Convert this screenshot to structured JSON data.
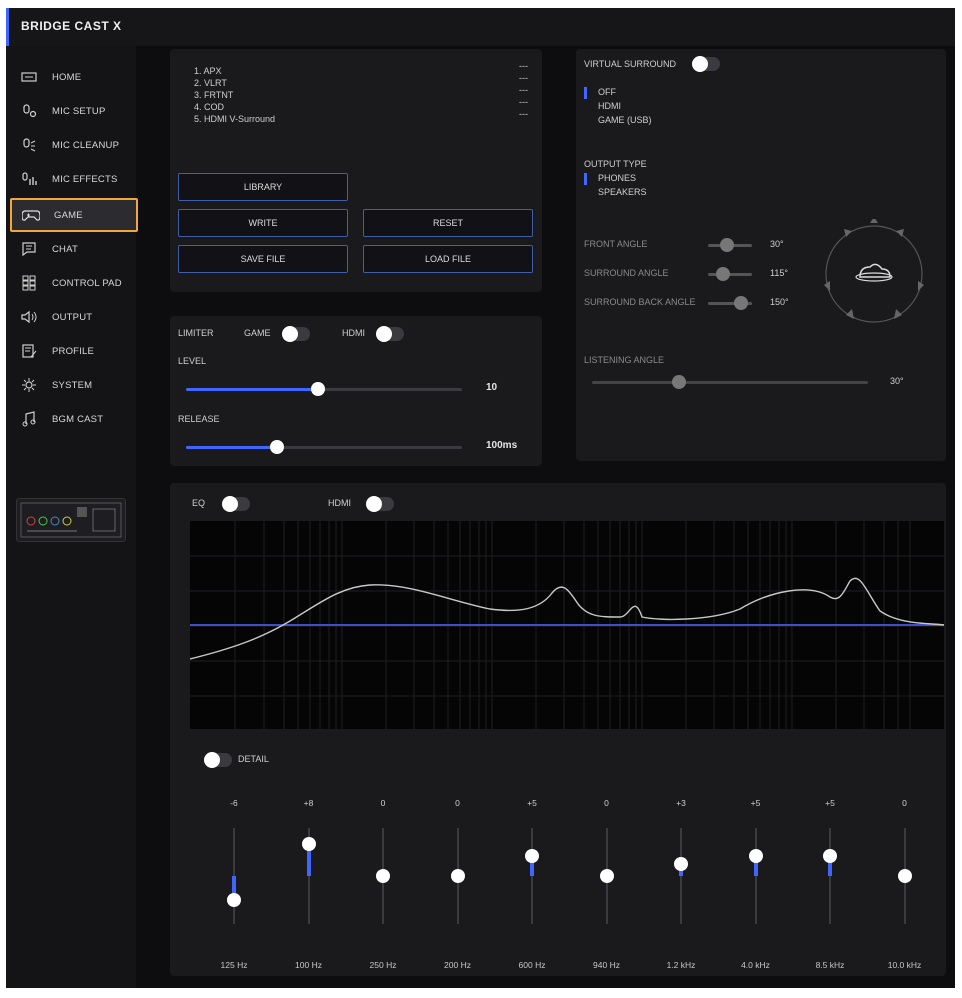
{
  "app": {
    "title": "BRIDGE CAST X"
  },
  "sidebar": {
    "items": [
      {
        "label": "HOME",
        "icon": "home-icon"
      },
      {
        "label": "MIC SETUP",
        "icon": "mic-setup-icon"
      },
      {
        "label": "MIC CLEANUP",
        "icon": "mic-cleanup-icon"
      },
      {
        "label": "MIC EFFECTS",
        "icon": "mic-effects-icon"
      },
      {
        "label": "GAME",
        "icon": "gamepad-icon",
        "active": true
      },
      {
        "label": "CHAT",
        "icon": "chat-icon"
      },
      {
        "label": "CONTROL PAD",
        "icon": "control-pad-icon"
      },
      {
        "label": "OUTPUT",
        "icon": "output-icon"
      },
      {
        "label": "PROFILE",
        "icon": "profile-icon"
      },
      {
        "label": "SYSTEM",
        "icon": "system-icon"
      },
      {
        "label": "BGM CAST",
        "icon": "music-icon"
      }
    ]
  },
  "library": {
    "presets": [
      {
        "name": "1. APX",
        "value": "---"
      },
      {
        "name": "2. VLRT",
        "value": "---"
      },
      {
        "name": "3. FRTNT",
        "value": "---"
      },
      {
        "name": "4. COD",
        "value": "---"
      },
      {
        "name": "5. HDMI V-Surround",
        "value": "---"
      }
    ],
    "library_label": "LIBRARY",
    "write_label": "WRITE",
    "reset_label": "RESET",
    "save_label": "SAVE FILE",
    "load_label": "LOAD FILE"
  },
  "limiter": {
    "title": "LIMITER",
    "game_label": "GAME",
    "hdmi_label": "HDMI",
    "level_label": "LEVEL",
    "level_value": "10",
    "level_fraction": 0.48,
    "release_label": "RELEASE",
    "release_value": "100ms",
    "release_fraction": 0.33
  },
  "surround": {
    "title": "VIRTUAL SURROUND",
    "modes": [
      "OFF",
      "HDMI",
      "GAME (USB)"
    ],
    "selected_mode": "OFF",
    "output_type_label": "OUTPUT TYPE",
    "output_types": [
      "PHONES",
      "SPEAKERS"
    ],
    "selected_output": "PHONES",
    "front_angle_label": "FRONT ANGLE",
    "front_angle_value": "30°",
    "surround_angle_label": "SURROUND ANGLE",
    "surround_angle_value": "115°",
    "surround_back_label": "SURROUND BACK ANGLE",
    "surround_back_value": "150°",
    "listening_angle_label": "LISTENING ANGLE",
    "listening_angle_value": "30°"
  },
  "eq": {
    "eq_label": "EQ",
    "hdmi_label": "HDMI",
    "detail_label": "DETAIL",
    "bands": [
      {
        "freq": "125 Hz",
        "value": "-6",
        "num": -6
      },
      {
        "freq": "100 Hz",
        "value": "+8",
        "num": 8
      },
      {
        "freq": "250 Hz",
        "value": "0",
        "num": 0
      },
      {
        "freq": "200 Hz",
        "value": "0",
        "num": 0
      },
      {
        "freq": "600 Hz",
        "value": "+5",
        "num": 5
      },
      {
        "freq": "940 Hz",
        "value": "0",
        "num": 0
      },
      {
        "freq": "1.2 kHz",
        "value": "+3",
        "num": 3
      },
      {
        "freq": "4.0 kHz",
        "value": "+5",
        "num": 5
      },
      {
        "freq": "8.5 kHz",
        "value": "+5",
        "num": 5
      },
      {
        "freq": "10.0 kHz",
        "value": "0",
        "num": 0
      }
    ]
  },
  "colors": {
    "accent": "#3f66ff",
    "highlight": "#f0a83a",
    "background": "#0d0d0f"
  }
}
